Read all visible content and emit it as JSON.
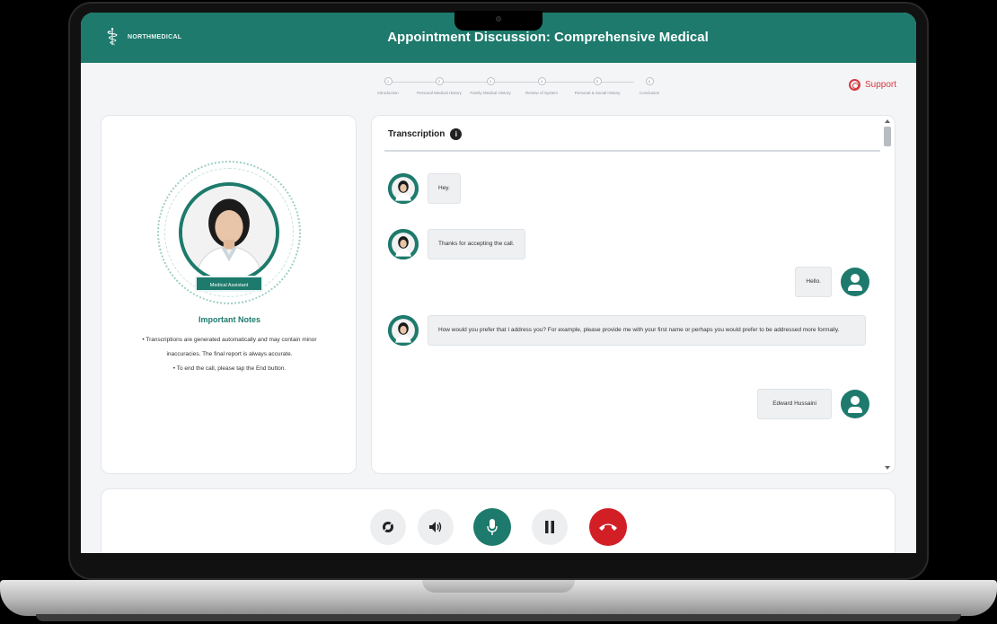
{
  "header": {
    "logo_text": "NORTHMEDICAL",
    "title": "Appointment Discussion: Comprehensive Medical"
  },
  "stepper": {
    "steps": [
      {
        "num": "1",
        "label": "Introduction"
      },
      {
        "num": "2",
        "label": "Personal Medical History"
      },
      {
        "num": "3",
        "label": "Family Medical History"
      },
      {
        "num": "4",
        "label": "Review of System"
      },
      {
        "num": "5",
        "label": "Personal & Social History"
      },
      {
        "num": "6",
        "label": "Conclusion"
      }
    ]
  },
  "support": {
    "label": "Support"
  },
  "left_panel": {
    "name": "Medical Assistant",
    "notes_title": "Important Notes",
    "notes": [
      "Transcriptions are generated automatically and may contain minor inaccuracies. The final report is always accurate.",
      "To end the call, please tap the End button."
    ]
  },
  "transcription": {
    "title": "Transcription",
    "info_icon": "info-icon",
    "messages": [
      {
        "from": "assistant",
        "text": "Hey."
      },
      {
        "from": "assistant",
        "text": "Thanks for accepting the call."
      },
      {
        "from": "user",
        "text": "Hello."
      },
      {
        "from": "assistant",
        "text": "How would you prefer that I address you? For example, please provide me with your first name or perhaps you would prefer to be addressed more formally."
      },
      {
        "from": "user",
        "text": "Edward Hussaini"
      }
    ]
  },
  "controls": {
    "buttons": [
      {
        "name": "camera-off-button",
        "icon": "camera-off-icon"
      },
      {
        "name": "speaker-button",
        "icon": "speaker-icon"
      },
      {
        "name": "mic-button",
        "icon": "mic-icon"
      },
      {
        "name": "pause-button",
        "icon": "pause-icon"
      },
      {
        "name": "end-call-button",
        "icon": "phone-hangup-icon"
      }
    ]
  },
  "colors": {
    "brand": "#1d7a6c",
    "danger": "#d21f26",
    "support": "#d9363e"
  }
}
